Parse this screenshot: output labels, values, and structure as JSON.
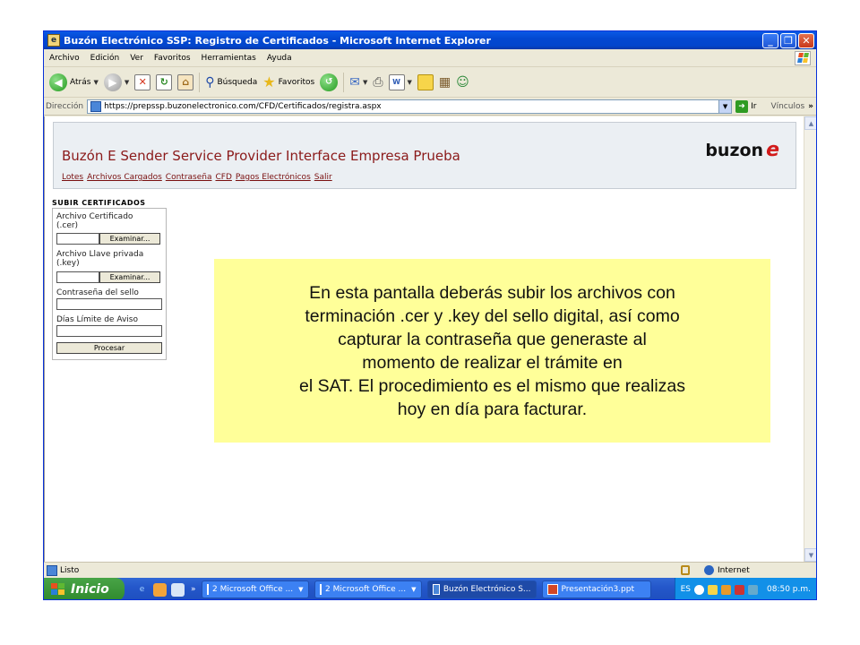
{
  "window": {
    "title": "Buzón Electrónico SSP: Registro de Certificados - Microsoft Internet Explorer"
  },
  "menu": [
    "Archivo",
    "Edición",
    "Ver",
    "Favoritos",
    "Herramientas",
    "Ayuda"
  ],
  "toolbar": {
    "back_label": "Atrás",
    "search_label": "Búsqueda",
    "favorites_label": "Favoritos"
  },
  "address": {
    "label": "Dirección",
    "url": "https://prepssp.buzonelectronico.com/CFD/Certificados/registra.aspx",
    "go_label": "Ir",
    "links_label": "Vínculos"
  },
  "page": {
    "site_title": "Buzón E Sender Service Provider Interface Empresa Prueba",
    "brand": "buzon",
    "brand_mark": "e",
    "nav": [
      "Lotes",
      "Archivos Cargados",
      "Contraseña",
      "CFD",
      "Pagos Electrónicos",
      "Salir"
    ],
    "form_title": "SUBIR CERTIFICADOS",
    "form": {
      "cert_label": "Archivo Certificado (.cer)",
      "key_label": "Archivo Llave privada (.key)",
      "browse_label": "Examinar...",
      "password_label": "Contraseña del sello",
      "days_label": "Días Límite de Aviso",
      "submit_label": "Procesar"
    }
  },
  "callout": {
    "lines": [
      "En esta pantalla deberás subir los archivos con",
      "terminación .cer y .key del sello digital, así como",
      "capturar la contraseña que generaste al",
      "momento de realizar el trámite en",
      "el SAT. El procedimiento es el mismo que realizas",
      "hoy en día para facturar."
    ]
  },
  "status": {
    "text": "Listo",
    "zone": "Internet"
  },
  "taskbar": {
    "start_label": "Inicio",
    "tasks": [
      "2 Microsoft Office ...",
      "2 Microsoft Office ...",
      "Buzón Electrónico S...",
      "Presentación3.ppt"
    ],
    "language": "ES",
    "clock": "08:50 p.m."
  },
  "colors": {
    "callout_bg": "#ffff99",
    "brand_accent": "#d21a1a",
    "link": "#7a1010"
  }
}
